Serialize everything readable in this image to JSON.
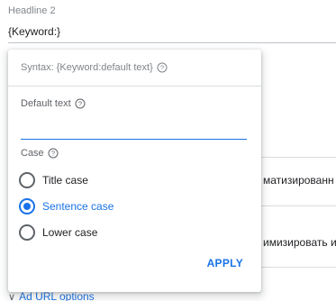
{
  "background": {
    "field_label": "Headline 2",
    "field_value": "{Keyword:}",
    "row1_text": "матизированн",
    "row2_text": "имизировать и",
    "link_text": "Ad URL options"
  },
  "popup": {
    "syntax_text": "Syntax: {Keyword:default text}",
    "default_label": "Default text",
    "default_value": "",
    "case_label": "Case",
    "options": [
      {
        "label": "Title case",
        "checked": false
      },
      {
        "label": "Sentence case",
        "checked": true
      },
      {
        "label": "Lower case",
        "checked": false
      }
    ],
    "apply_label": "APPLY"
  },
  "colors": {
    "accent": "#1a73e8",
    "muted_text": "#80868b"
  }
}
